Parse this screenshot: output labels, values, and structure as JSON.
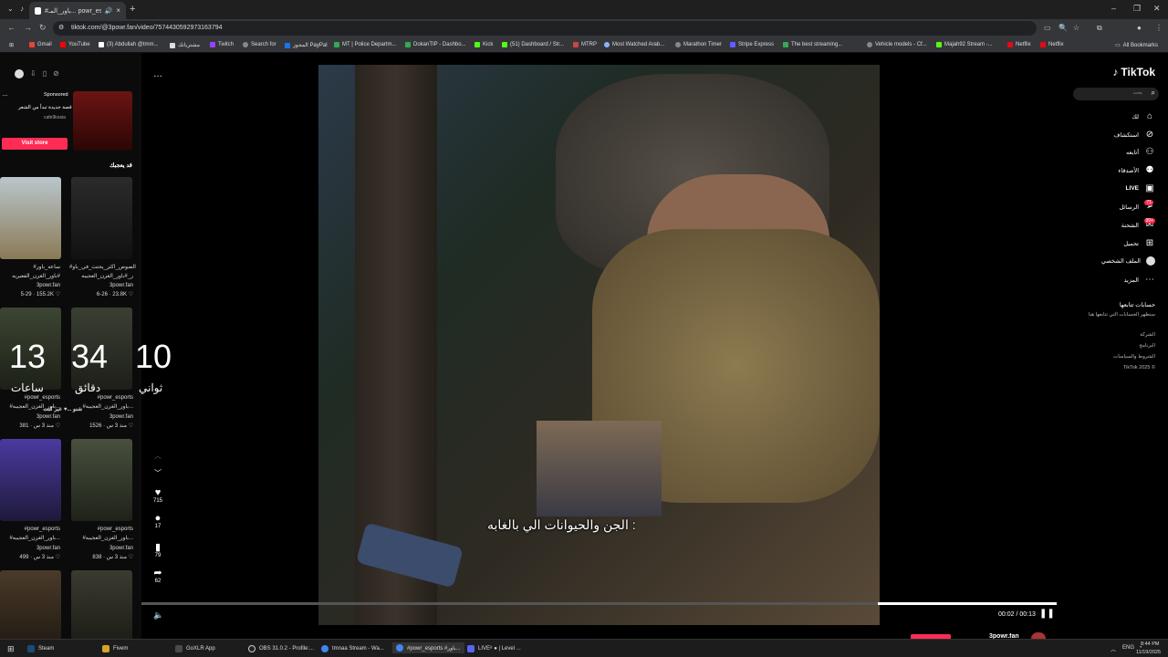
{
  "browser": {
    "tab_title": "#باور_المـ... powr_esports#",
    "url": "tiktok.com/@3powr.fan/video/7574430592973163794",
    "bookmarks": [
      "Gmail",
      "YouTube",
      "(3) Abdullah @tmm...",
      "مشترياتك",
      "Twitch",
      "Search for",
      "المجوز PayPal",
      "MT | Police Departm...",
      "DokanTIP - Dashbo...",
      "Kick",
      "(51) Dashboard / Str...",
      "MTRP",
      "Most Watched Arab...",
      "Marathon Timer",
      "Stripe Express",
      "The best streaming...",
      "Vehicle models - Cf...",
      "Majah92 Stream -...",
      "Netflix",
      "Netflix"
    ],
    "all_bookmarks": "All Bookmarks"
  },
  "left": {
    "sponsored": "Sponsored",
    "sponsor_text": "قصة جديدة تبدأ من الشعر",
    "sponsor_brand": "cafe9kosia",
    "visit_store": "Visit store",
    "section_title": "قد يعجبك",
    "thumbs": [
      {
        "title": "#ساعه_باور #باور_الغزن_الفعيريه",
        "user": "3powr.fan",
        "meta": "5-29 · 155.2K ♡"
      },
      {
        "title": "#الصوص_اكثر_يحتث_في_باو ر_#باور_الغزن_العجيبه",
        "user": "3powr.fan",
        "meta": "6-26 · 23.8K ♡"
      },
      {
        "title": "#powr_esports #باور_الغزن_العجيبه...",
        "user": "3powr.fan",
        "meta": "منذ 3 س · 381 ♡"
      },
      {
        "title": "#powr_esports #باور_الغزن_العجيبه...",
        "user": "3powr.fan",
        "meta": "منذ 3 س · 1526 ♡"
      },
      {
        "title": "#powr_esports #باور_الغزن_العجيبه...",
        "user": "3powr.fan",
        "meta": "منذ 3 س · 499 ♡"
      },
      {
        "title": "#powr_esports #باور_الغزن_العجيبه...",
        "user": "3powr.fan",
        "meta": "منذ 3 س · 838 ♡"
      }
    ],
    "overlay_text": "شنو ...♥ عبر كنت"
  },
  "countdown": {
    "hours": "13",
    "hours_label": "ساعات",
    "minutes": "34",
    "minutes_label": "دقائق",
    "seconds": "10",
    "seconds_label": "ثواني"
  },
  "actions": {
    "likes": "715",
    "comments": "17",
    "saves": "79",
    "shares": "62"
  },
  "video": {
    "subtitle": "الجن والحيوانات الي بالغابه :",
    "time": "00:02 / 00:13",
    "progress_played": 0.805
  },
  "right": {
    "logo": "TikTok",
    "search_placeholder": "بحث",
    "nav": [
      "لك",
      "استكشاف",
      "أتابعه",
      "الأصدقاء",
      "LIVE",
      "الرسائل",
      "الشحنة",
      "تحميل",
      "الملف الشخصي",
      "المزيد"
    ],
    "messages_badge": "71",
    "inbox_badge": "99+",
    "following_title": "حسابات تتابعها",
    "following_sub": "ستظهر الحسابات التي تتابعها هنا",
    "footer": [
      "الشركة",
      "البرنامج",
      "الشروط والسياسات",
      "TikTok 2025 ©"
    ],
    "bottom_user": "3powr.fan"
  },
  "taskbar": {
    "items": [
      "Steam",
      "Fivem",
      "GoXLR App",
      "OBS 31.0.2 - Profile:...",
      "tmnaa Stream - Wa...",
      "#powr_esports #باور...",
      "LIVE⁸ ● | Level ..."
    ],
    "lang": "ENG",
    "time": "8:44 PM",
    "date": "11/19/2025"
  }
}
